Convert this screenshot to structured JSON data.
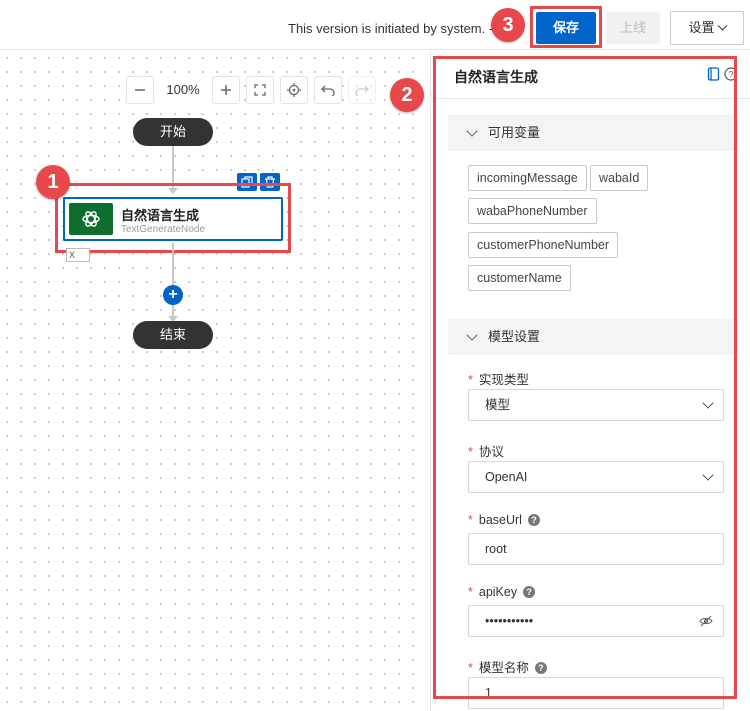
{
  "topbar": {
    "message": "This version is initiated by system. - 版",
    "save_label": "保存",
    "online_label": "上线",
    "settings_label": "设置"
  },
  "annotations": {
    "one": "1",
    "two": "2",
    "three": "3"
  },
  "canvas": {
    "zoom": "100%",
    "start_label": "开始",
    "end_label": "结束",
    "node": {
      "title": "自然语言生成",
      "subtitle": "TextGenerateNode"
    },
    "node_small_box": "X"
  },
  "panel": {
    "title": "自然语言生成",
    "section_variables": "可用变量",
    "variables": [
      "incomingMessage",
      "wabaId",
      "wabaPhoneNumber",
      "customerPhoneNumber",
      "customerName"
    ],
    "section_model": "模型设置",
    "fields": {
      "impl_type": {
        "label": "实现类型",
        "value": "模型"
      },
      "protocol": {
        "label": "协议",
        "value": "OpenAI"
      },
      "base_url": {
        "label": "baseUrl",
        "value": "root"
      },
      "api_key": {
        "label": "apiKey",
        "value": "•••••••••••"
      },
      "model_name": {
        "label": "模型名称",
        "value": "1"
      }
    }
  },
  "colors": {
    "accent": "#0064c8",
    "annotation": "#e8474b",
    "node_logo_bg": "#0d6e2d"
  }
}
